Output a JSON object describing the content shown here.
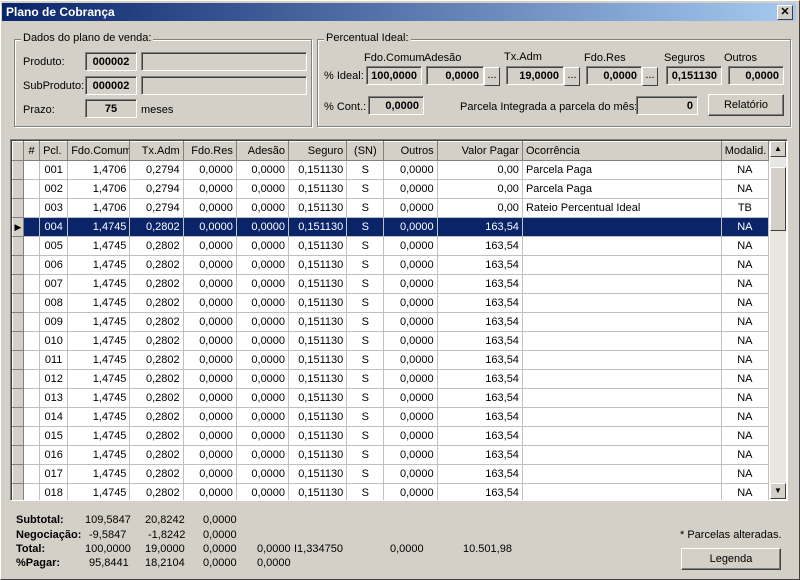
{
  "window": {
    "title": "Plano de Cobrança",
    "close_glyph": "✕"
  },
  "dados": {
    "legend": "Dados do plano de venda:",
    "produto_label": "Produto:",
    "produto_value": "000002",
    "produto_desc": "",
    "subproduto_label": "SubProduto:",
    "subproduto_value": "000002",
    "subproduto_desc": "",
    "prazo_label": "Prazo:",
    "prazo_value": "75",
    "prazo_unit": "meses"
  },
  "percentual": {
    "legend": "Percentual Ideal:",
    "headers": {
      "fdo_comum": "Fdo.Comum",
      "adesao": "Adesão",
      "tx_adm": "Tx.Adm",
      "fdo_res": "Fdo.Res",
      "seguros": "Seguros",
      "outros": "Outros"
    },
    "ideal_label": "% Ideal:",
    "ideal": {
      "fdo_comum": "100,0000",
      "adesao": "0,0000",
      "tx_adm": "19,0000",
      "fdo_res": "0,0000",
      "seguros": "0,151130",
      "outros": "0,0000"
    },
    "cont_label": "% Cont.:",
    "cont_value": "0,0000",
    "parcela_label": "Parcela Integrada a parcela do mês:",
    "parcela_value": "0",
    "dots": "...",
    "relatorio_button": "Relatório"
  },
  "grid": {
    "columns": [
      "#",
      "Pcl.",
      "Fdo.Comum",
      "Tx.Adm",
      "Fdo.Res",
      "Adesão",
      "Seguro",
      "(SN)",
      "Outros",
      "Valor Pagar",
      "Ocorrência",
      "Modalid."
    ],
    "selected_marker": "▶",
    "rows": [
      [
        "001",
        "1,4706",
        "0,2794",
        "0,0000",
        "0,0000",
        "0,151130",
        "S",
        "0,0000",
        "0,00",
        "Parcela Paga",
        "NA"
      ],
      [
        "002",
        "1,4706",
        "0,2794",
        "0,0000",
        "0,0000",
        "0,151130",
        "S",
        "0,0000",
        "0,00",
        "Parcela Paga",
        "NA"
      ],
      [
        "003",
        "1,4706",
        "0,2794",
        "0,0000",
        "0,0000",
        "0,151130",
        "S",
        "0,0000",
        "0,00",
        "Rateio Percentual Ideal",
        "TB"
      ],
      [
        "004",
        "1,4745",
        "0,2802",
        "0,0000",
        "0,0000",
        "0,151130",
        "S",
        "0,0000",
        "163,54",
        "",
        "NA"
      ],
      [
        "005",
        "1,4745",
        "0,2802",
        "0,0000",
        "0,0000",
        "0,151130",
        "S",
        "0,0000",
        "163,54",
        "",
        "NA"
      ],
      [
        "006",
        "1,4745",
        "0,2802",
        "0,0000",
        "0,0000",
        "0,151130",
        "S",
        "0,0000",
        "163,54",
        "",
        "NA"
      ],
      [
        "007",
        "1,4745",
        "0,2802",
        "0,0000",
        "0,0000",
        "0,151130",
        "S",
        "0,0000",
        "163,54",
        "",
        "NA"
      ],
      [
        "008",
        "1,4745",
        "0,2802",
        "0,0000",
        "0,0000",
        "0,151130",
        "S",
        "0,0000",
        "163,54",
        "",
        "NA"
      ],
      [
        "009",
        "1,4745",
        "0,2802",
        "0,0000",
        "0,0000",
        "0,151130",
        "S",
        "0,0000",
        "163,54",
        "",
        "NA"
      ],
      [
        "010",
        "1,4745",
        "0,2802",
        "0,0000",
        "0,0000",
        "0,151130",
        "S",
        "0,0000",
        "163,54",
        "",
        "NA"
      ],
      [
        "011",
        "1,4745",
        "0,2802",
        "0,0000",
        "0,0000",
        "0,151130",
        "S",
        "0,0000",
        "163,54",
        "",
        "NA"
      ],
      [
        "012",
        "1,4745",
        "0,2802",
        "0,0000",
        "0,0000",
        "0,151130",
        "S",
        "0,0000",
        "163,54",
        "",
        "NA"
      ],
      [
        "013",
        "1,4745",
        "0,2802",
        "0,0000",
        "0,0000",
        "0,151130",
        "S",
        "0,0000",
        "163,54",
        "",
        "NA"
      ],
      [
        "014",
        "1,4745",
        "0,2802",
        "0,0000",
        "0,0000",
        "0,151130",
        "S",
        "0,0000",
        "163,54",
        "",
        "NA"
      ],
      [
        "015",
        "1,4745",
        "0,2802",
        "0,0000",
        "0,0000",
        "0,151130",
        "S",
        "0,0000",
        "163,54",
        "",
        "NA"
      ],
      [
        "016",
        "1,4745",
        "0,2802",
        "0,0000",
        "0,0000",
        "0,151130",
        "S",
        "0,0000",
        "163,54",
        "",
        "NA"
      ],
      [
        "017",
        "1,4745",
        "0,2802",
        "0,0000",
        "0,0000",
        "0,151130",
        "S",
        "0,0000",
        "163,54",
        "",
        "NA"
      ],
      [
        "018",
        "1,4745",
        "0,2802",
        "0,0000",
        "0,0000",
        "0,151130",
        "S",
        "0,0000",
        "163,54",
        "",
        "NA"
      ]
    ],
    "selected_row": 3,
    "scroll_up": "▲",
    "scroll_down": "▼"
  },
  "totals": {
    "subtotal": {
      "label": "Subtotal:",
      "values": [
        "109,5847",
        "20,8242",
        "0,0000"
      ]
    },
    "negociacao": {
      "label": "Negociação:",
      "values": [
        "-9,5847",
        "-1,8242",
        "0,0000"
      ]
    },
    "total": {
      "label": "Total:",
      "values": [
        "100,0000",
        "19,0000",
        "0,0000",
        "0,0000",
        "I1,334750",
        "0,0000",
        "10.501,98"
      ]
    },
    "pagar": {
      "label": "%Pagar:",
      "values": [
        "95,8441",
        "18,2104",
        "0,0000",
        "0,0000"
      ]
    },
    "note": "* Parcelas alteradas.",
    "legenda_button": "Legenda"
  },
  "colors": {
    "selection": "#0a246a",
    "title_start": "#0a246a",
    "title_end": "#a6caf0"
  }
}
